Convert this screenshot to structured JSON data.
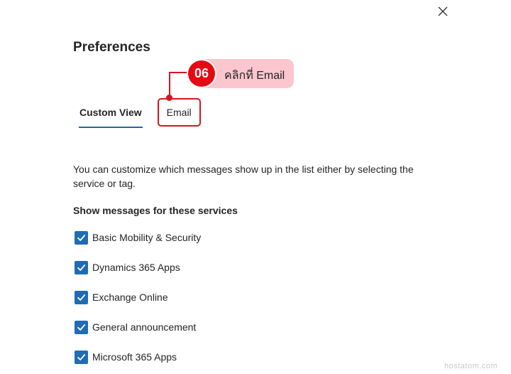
{
  "panel": {
    "title": "Preferences",
    "close_icon": "close-icon"
  },
  "tabs": [
    {
      "label": "Custom View",
      "selected": true
    },
    {
      "label": "Email",
      "selected": false
    }
  ],
  "callout": {
    "number": "06",
    "text": "คลิกที่ Email",
    "color": "#e50914",
    "bg_color": "#fbc6cd"
  },
  "description": "You can customize which messages show up in the list either by selecting the service or tag.",
  "services_section": {
    "heading": "Show messages for these services",
    "items": [
      {
        "label": "Basic Mobility & Security",
        "checked": true
      },
      {
        "label": "Dynamics 365 Apps",
        "checked": true
      },
      {
        "label": "Exchange Online",
        "checked": true
      },
      {
        "label": "General announcement",
        "checked": true
      },
      {
        "label": "Microsoft 365 Apps",
        "checked": true
      }
    ]
  },
  "watermark": "hostatom.com",
  "colors": {
    "accent": "#1f6a9e",
    "checkbox": "#1f6cb5",
    "highlight": "#d9141e"
  }
}
